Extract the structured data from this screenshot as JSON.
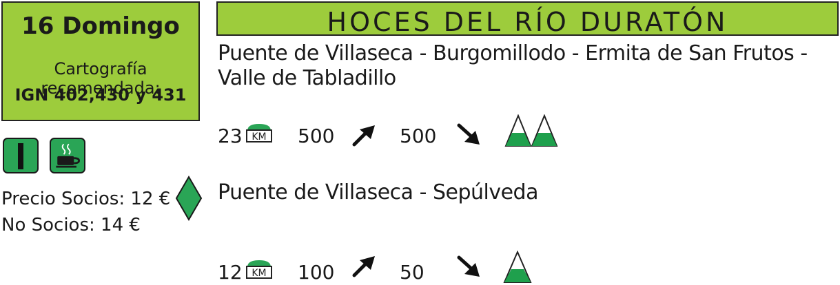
{
  "day_box": {
    "date": "16 Domingo",
    "cartography_label": "Cartografía recomendada:",
    "maps": "IGN 402,430 y 431",
    "color": "#9dcc3c"
  },
  "title": "HOCES DEL RÍO DURATÓN",
  "routes": [
    {
      "name": "Puente de Villaseca - Burgomillodo - Ermita de San Frutos - Valle de Tabladillo",
      "distance": "23",
      "km_label": "KM",
      "ascent": "500",
      "descent": "500",
      "difficulty_icon": "double-peak-icon"
    },
    {
      "name": "Puente de Villaseca - Sepúlveda",
      "distance": "12",
      "km_label": "KM",
      "ascent": "100",
      "descent": "50",
      "difficulty_icon": "single-peak-icon"
    }
  ],
  "badges": {
    "level_icon": "level-one-icon",
    "cafe_icon": "coffee-cup-icon",
    "color": "#2aa556"
  },
  "prices": {
    "members": "Precio Socios: 12 €",
    "non_members": "No Socios: 14 €",
    "diamond_color": "#2aa556"
  }
}
